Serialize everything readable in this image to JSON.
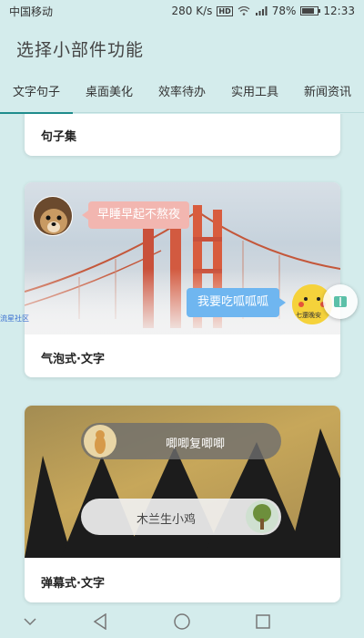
{
  "status_bar": {
    "carrier": "中国移动",
    "speed": "280 K/s",
    "hd": "HD",
    "battery_percent": "78%",
    "battery_level": 0.78,
    "time": "12:33"
  },
  "page": {
    "title": "选择小部件功能"
  },
  "tabs": [
    {
      "label": "文字句子",
      "active": true
    },
    {
      "label": "桌面美化",
      "active": false
    },
    {
      "label": "效率待办",
      "active": false
    },
    {
      "label": "实用工具",
      "active": false
    },
    {
      "label": "新闻资讯",
      "active": false
    }
  ],
  "cards": [
    {
      "label": "句子集"
    },
    {
      "label": "气泡式·文字",
      "bubble_left": "早睡早起不熬夜",
      "bubble_right": "我要吃呱呱呱",
      "avatar_right_caption": "七還晚安"
    },
    {
      "label": "弹幕式·文字",
      "danmaku_1": "唧唧复唧唧",
      "danmaku_2": "木兰生小鸡"
    }
  ],
  "watermark": {
    "side": "流星社区"
  },
  "colors": {
    "background": "#d4ecec",
    "tab_indicator": "#1f8c8c",
    "bubble_pink": "#f2b6b0",
    "bubble_blue": "#6fb6f0"
  },
  "icons": {
    "nav_back": "triangle-left",
    "nav_home": "circle",
    "nav_recent": "square",
    "nav_down": "chevron-down"
  }
}
